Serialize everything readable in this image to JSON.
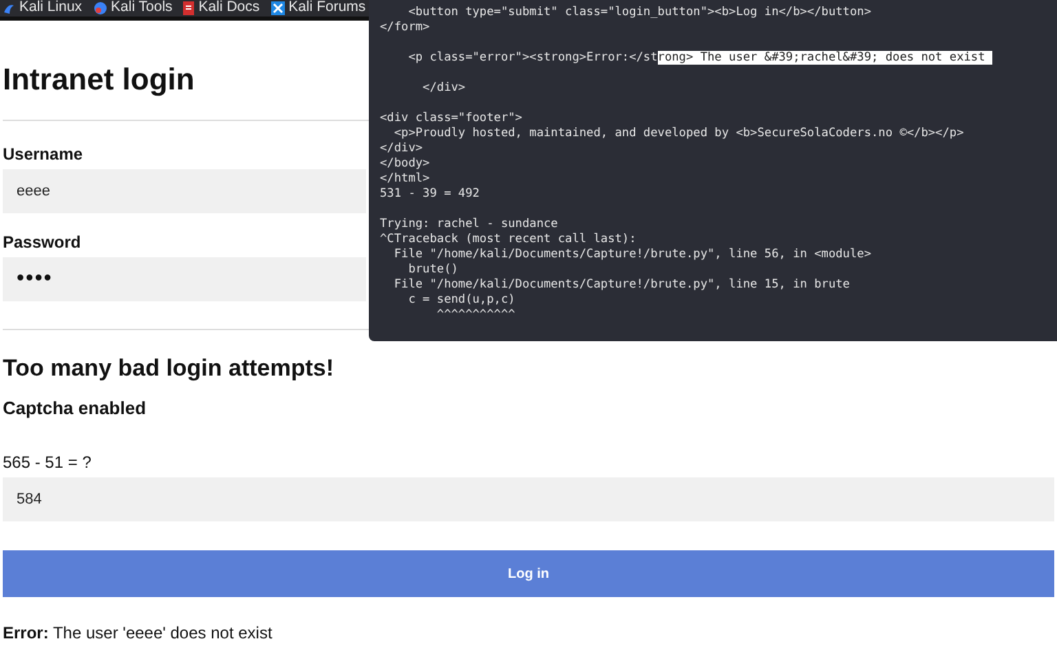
{
  "bookmarks": [
    {
      "label": "Kali Linux"
    },
    {
      "label": "Kali Tools"
    },
    {
      "label": "Kali Docs"
    },
    {
      "label": "Kali Forums"
    }
  ],
  "page": {
    "title": "Intranet login",
    "fields": [
      {
        "label": "Username",
        "value": "eeee",
        "kind": "text"
      },
      {
        "label": "Password",
        "value": "••••",
        "kind": "password"
      }
    ],
    "warning": "Too many bad login attempts!",
    "captcha_heading": "Captcha enabled",
    "captcha_question": "565 - 51 = ?",
    "captcha_value": "584",
    "submit": "Log in",
    "error": "**Error:** The user 'eeee' does not exist"
  },
  "terminal": {
    "lines": [
      {
        "kind": "text",
        "segments": [
          {
            "text": "    <button type=\"submit\" class=\"login_button\"><b>Log in</b></button>",
            "selected": false
          }
        ]
      },
      {
        "kind": "text",
        "segments": [
          {
            "text": "</form>",
            "selected": false
          }
        ]
      },
      {
        "kind": "blank"
      },
      {
        "kind": "text",
        "segments": [
          {
            "text": "    <p class=\"error\"><strong>Error:</st",
            "selected": false
          },
          {
            "text": "rong> The user &#39;rachel&#39; does not exist ",
            "selected": true
          }
        ]
      },
      {
        "kind": "blank"
      },
      {
        "kind": "text",
        "segments": [
          {
            "text": "      </div>",
            "selected": false
          }
        ]
      },
      {
        "kind": "blank"
      },
      {
        "kind": "text",
        "segments": [
          {
            "text": "<div class=\"footer\">",
            "selected": false
          }
        ]
      },
      {
        "kind": "text",
        "segments": [
          {
            "text": "  <p>Proudly hosted, maintained, and developed by <b>SecureSolaCoders.no ©</b></p>",
            "selected": false
          }
        ]
      },
      {
        "kind": "text",
        "segments": [
          {
            "text": "</div>",
            "selected": false
          }
        ]
      },
      {
        "kind": "text",
        "segments": [
          {
            "text": "</body>",
            "selected": false
          }
        ]
      },
      {
        "kind": "text",
        "segments": [
          {
            "text": "</html>",
            "selected": false
          }
        ]
      },
      {
        "kind": "text",
        "segments": [
          {
            "text": "531 - 39 = 492",
            "selected": false
          }
        ]
      },
      {
        "kind": "blank"
      },
      {
        "kind": "text",
        "segments": [
          {
            "text": "Trying: rachel - sundance",
            "selected": false
          }
        ]
      },
      {
        "kind": "text",
        "segments": [
          {
            "text": "^CTraceback (most recent call last):",
            "selected": false
          }
        ]
      },
      {
        "kind": "text",
        "segments": [
          {
            "text": "  File \"/home/kali/Documents/Capture!/brute.py\", line 56, in <module>",
            "selected": false
          }
        ]
      },
      {
        "kind": "text",
        "segments": [
          {
            "text": "    brute()",
            "selected": false
          }
        ]
      },
      {
        "kind": "text",
        "segments": [
          {
            "text": "  File \"/home/kali/Documents/Capture!/brute.py\", line 15, in brute",
            "selected": false
          }
        ]
      },
      {
        "kind": "text",
        "segments": [
          {
            "text": "    c = send(u,p,c)",
            "selected": false
          }
        ]
      },
      {
        "kind": "text",
        "segments": [
          {
            "text": "        ^^^^^^^^^^^",
            "selected": false
          }
        ]
      }
    ]
  }
}
